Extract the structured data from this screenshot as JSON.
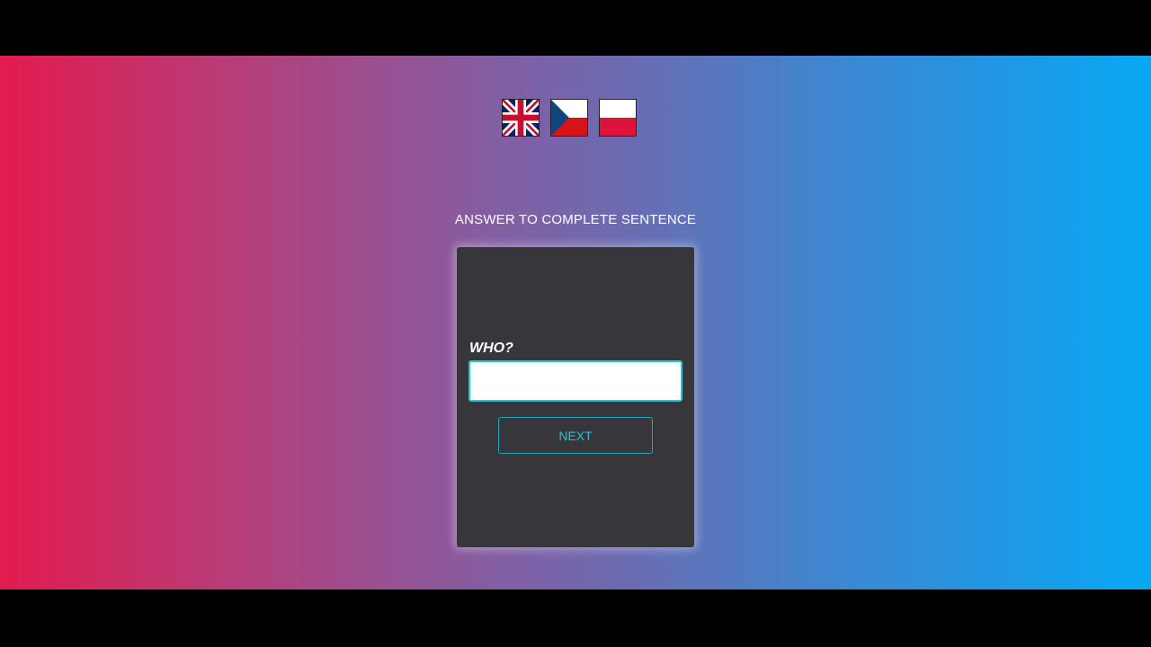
{
  "flags": [
    {
      "name": "uk-flag-icon",
      "language": "English"
    },
    {
      "name": "czech-flag-icon",
      "language": "Czech"
    },
    {
      "name": "polish-flag-icon",
      "language": "Polish"
    }
  ],
  "heading": "ANSWER TO COMPLETE SENTENCE",
  "card": {
    "question": "WHO?",
    "answer_value": "",
    "answer_placeholder": "",
    "next_label": "NEXT"
  },
  "colors": {
    "gradient_left": "#e31b4f",
    "gradient_right": "#08a8f4",
    "card_bg": "#37363b",
    "accent": "#22c6d8"
  }
}
